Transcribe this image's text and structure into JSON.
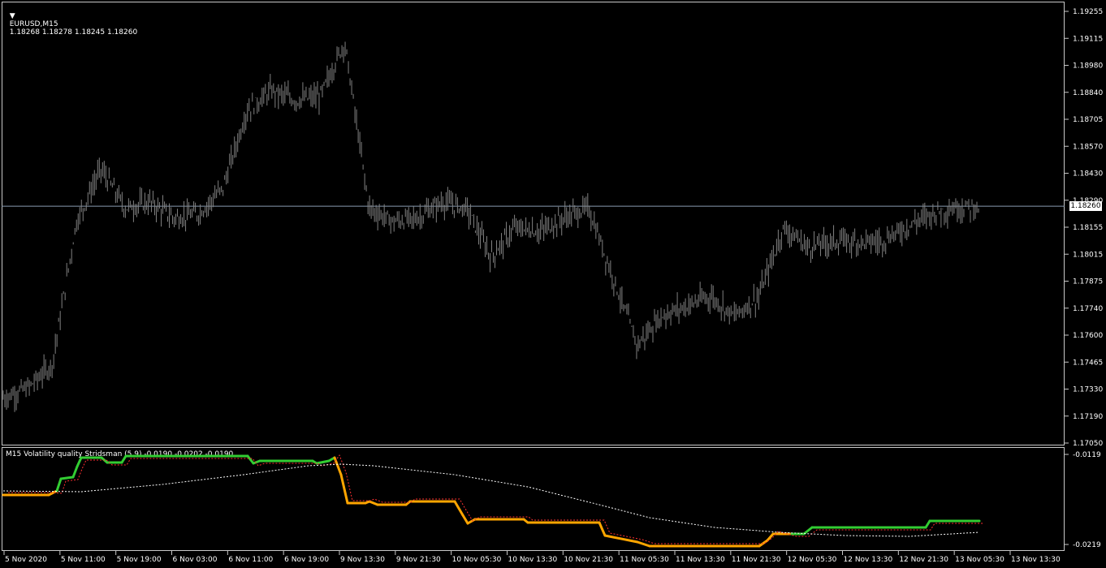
{
  "chart_header": {
    "symbol": "EURUSD,M15",
    "ohlc": "1.18268 1.18278 1.18245 1.18260"
  },
  "current_price_label": "1.18260",
  "indicator_header": "M15 Volatility quality Stridsman (5,9) -0.0190 -0.0202 -0.0190",
  "indicator_axis": [
    "-0.0119",
    "-0.0219"
  ],
  "colors": {
    "background": "#000000",
    "candles": "#808080",
    "grid_border": "#c8c8c8",
    "vq_up": "#32cd32",
    "vq_down": "#ffa500",
    "signal": "#ff3030",
    "ma": "#ffffff"
  },
  "chart_data": {
    "type": "line",
    "title": "EURUSD,M15",
    "price_axis": [
      "1.19255",
      "1.19115",
      "1.18980",
      "1.18840",
      "1.18705",
      "1.18570",
      "1.18430",
      "1.18290",
      "1.18155",
      "1.18015",
      "1.17875",
      "1.17740",
      "1.17600",
      "1.17465",
      "1.17330",
      "1.17190",
      "1.17050"
    ],
    "time_axis": [
      "5 Nov 2020",
      "5 Nov 11:00",
      "5 Nov 19:00",
      "6 Nov 03:00",
      "6 Nov 11:00",
      "6 Nov 19:00",
      "9 Nov 13:30",
      "9 Nov 21:30",
      "10 Nov 05:30",
      "10 Nov 13:30",
      "10 Nov 21:30",
      "11 Nov 05:30",
      "11 Nov 13:30",
      "11 Nov 21:30",
      "12 Nov 05:30",
      "12 Nov 13:30",
      "12 Nov 21:30",
      "13 Nov 05:30",
      "13 Nov 13:30"
    ],
    "ylim": [
      1.1705,
      1.19255
    ],
    "current_price": 1.1826,
    "price_series": [
      {
        "t": "5 Nov 2020",
        "p": 1.1728
      },
      {
        "t": "5 Nov 03:00",
        "p": 1.1733
      },
      {
        "t": "5 Nov 07:00",
        "p": 1.1745
      },
      {
        "t": "5 Nov 11:00",
        "p": 1.1818
      },
      {
        "t": "5 Nov 13:00",
        "p": 1.1845
      },
      {
        "t": "5 Nov 15:00",
        "p": 1.1825
      },
      {
        "t": "5 Nov 19:00",
        "p": 1.1828
      },
      {
        "t": "5 Nov 23:00",
        "p": 1.182
      },
      {
        "t": "6 Nov 03:00",
        "p": 1.1822
      },
      {
        "t": "6 Nov 07:00",
        "p": 1.1835
      },
      {
        "t": "6 Nov 11:00",
        "p": 1.1875
      },
      {
        "t": "6 Nov 15:00",
        "p": 1.1885
      },
      {
        "t": "6 Nov 19:00",
        "p": 1.188
      },
      {
        "t": "6 Nov 23:00",
        "p": 1.1882
      },
      {
        "t": "9 Nov 12:00",
        "p": 1.191
      },
      {
        "t": "9 Nov 13:30",
        "p": 1.1825
      },
      {
        "t": "9 Nov 17:00",
        "p": 1.1818
      },
      {
        "t": "9 Nov 21:30",
        "p": 1.182
      },
      {
        "t": "10 Nov 01:30",
        "p": 1.1828
      },
      {
        "t": "10 Nov 05:30",
        "p": 1.1825
      },
      {
        "t": "10 Nov 09:30",
        "p": 1.18
      },
      {
        "t": "10 Nov 13:30",
        "p": 1.1815
      },
      {
        "t": "10 Nov 17:30",
        "p": 1.1813
      },
      {
        "t": "10 Nov 21:30",
        "p": 1.182
      },
      {
        "t": "11 Nov 01:30",
        "p": 1.1825
      },
      {
        "t": "11 Nov 05:30",
        "p": 1.179
      },
      {
        "t": "11 Nov 09:30",
        "p": 1.1755
      },
      {
        "t": "11 Nov 13:30",
        "p": 1.177
      },
      {
        "t": "11 Nov 17:30",
        "p": 1.1775
      },
      {
        "t": "11 Nov 21:30",
        "p": 1.178
      },
      {
        "t": "12 Nov 01:30",
        "p": 1.177
      },
      {
        "t": "12 Nov 05:30",
        "p": 1.178
      },
      {
        "t": "12 Nov 09:30",
        "p": 1.1815
      },
      {
        "t": "12 Nov 13:30",
        "p": 1.1805
      },
      {
        "t": "12 Nov 17:30",
        "p": 1.1808
      },
      {
        "t": "12 Nov 21:30",
        "p": 1.1808
      },
      {
        "t": "13 Nov 01:30",
        "p": 1.1808
      },
      {
        "t": "13 Nov 05:30",
        "p": 1.1815
      },
      {
        "t": "13 Nov 09:30",
        "p": 1.1822
      },
      {
        "t": "13 Nov 13:30",
        "p": 1.1825
      },
      {
        "t": "13 Nov 15:30",
        "p": 1.1826
      }
    ]
  }
}
